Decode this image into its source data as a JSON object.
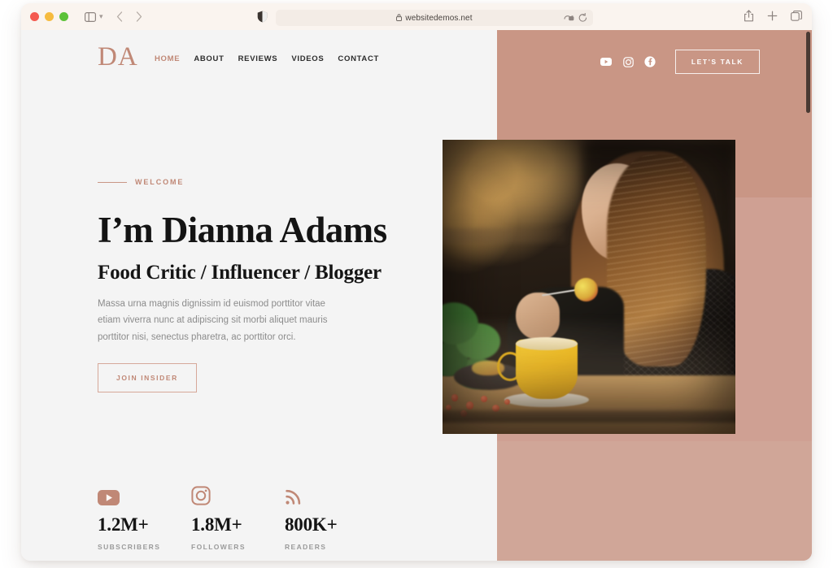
{
  "browser": {
    "traffic_lights": [
      "close",
      "minimize",
      "zoom"
    ],
    "sidebar_toggle": "sidebar-icon",
    "sidebar_chevron": "chevron-down-icon",
    "back": "back-chevron-icon",
    "forward": "forward-chevron-icon",
    "shield": "shield-icon",
    "url": "websitedemos.net",
    "lock": "lock-icon",
    "extension": "extension-icon",
    "reload": "reload-icon",
    "share": "share-icon",
    "new_tab": "plus-icon",
    "tab_overview": "tabs-icon"
  },
  "site": {
    "logo": "DA",
    "nav": [
      {
        "label": "HOME",
        "active": true
      },
      {
        "label": "ABOUT",
        "active": false
      },
      {
        "label": "REVIEWS",
        "active": false
      },
      {
        "label": "VIDEOS",
        "active": false
      },
      {
        "label": "CONTACT",
        "active": false
      }
    ],
    "social": [
      {
        "name": "youtube-icon"
      },
      {
        "name": "instagram-icon"
      },
      {
        "name": "facebook-icon"
      }
    ],
    "cta_header": "LET'S TALK"
  },
  "hero": {
    "eyebrow": "WELCOME",
    "title": "I’m Dianna Adams",
    "subtitle": "Food Critic / Influencer / Blogger",
    "paragraph": "Massa urna magnis dignissim id euismod porttitor vitae etiam viverra nunc at adipiscing sit morbi aliquet mauris porttitor nisi, senectus pharetra, ac porttitor orci.",
    "cta": "JOIN INSIDER",
    "image_alt": "woman eating dessert at a cafe table with a yellow coffee cup"
  },
  "stats": [
    {
      "icon": "youtube-icon",
      "value": "1.2M+",
      "label": "SUBSCRIBERS"
    },
    {
      "icon": "instagram-icon",
      "value": "1.8M+",
      "label": "FOLLOWERS"
    },
    {
      "icon": "rss-icon",
      "value": "800K+",
      "label": "READERS"
    }
  ],
  "colors": {
    "accent": "#c08876",
    "rose_panel": "#c99685",
    "page_bg": "#f4f4f4",
    "heading": "#141414",
    "body_text": "#8c8c8c"
  }
}
